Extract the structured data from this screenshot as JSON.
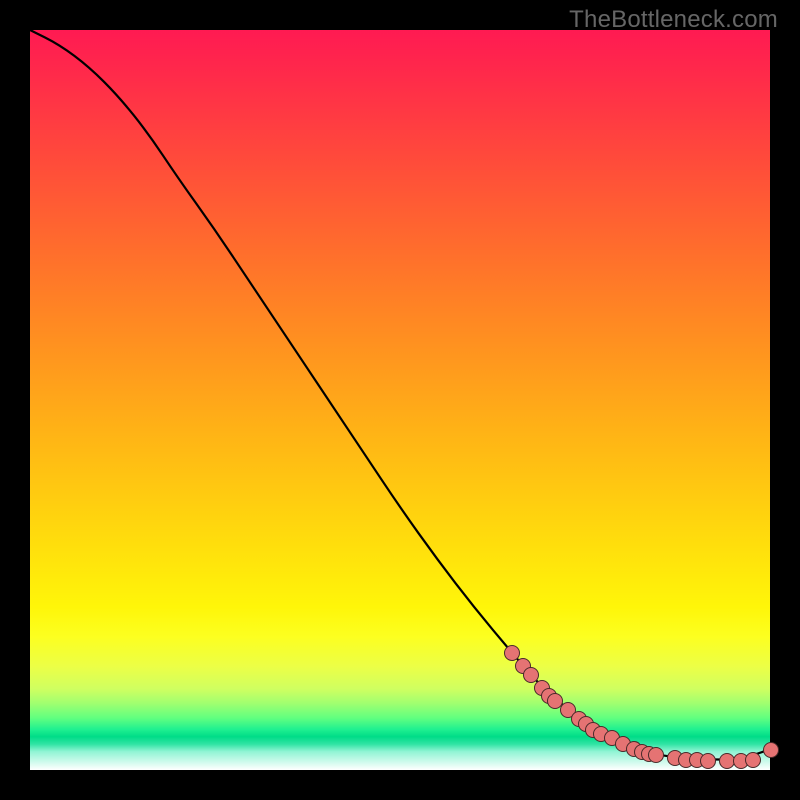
{
  "watermark": "TheBottleneck.com",
  "colors": {
    "background": "#000000",
    "line": "#000000",
    "dot_fill": "#e57373",
    "dot_stroke": "#4a2a2a"
  },
  "chart_data": {
    "type": "line",
    "title": "",
    "xlabel": "",
    "ylabel": "",
    "xlim": [
      0,
      100
    ],
    "ylim": [
      0,
      100
    ],
    "series": [
      {
        "name": "curve",
        "x": [
          0,
          4,
          8,
          12,
          16,
          20,
          25,
          30,
          35,
          40,
          45,
          50,
          55,
          60,
          65,
          68,
          70,
          72,
          74,
          76,
          78,
          80,
          82,
          84,
          88,
          92,
          96,
          100
        ],
        "y": [
          100,
          98,
          95,
          91,
          86,
          80,
          73,
          65.5,
          58,
          50.5,
          43,
          35.5,
          28.5,
          22,
          16,
          12.5,
          10.5,
          8.8,
          7.2,
          5.8,
          4.6,
          3.6,
          2.8,
          2.2,
          1.6,
          1.4,
          1.4,
          2.8
        ]
      }
    ],
    "highlight_points": {
      "x": [
        65,
        66.5,
        67.5,
        69,
        70,
        70.8,
        72.5,
        74,
        75,
        76,
        77,
        78.5,
        80,
        81.5,
        82.5,
        83.5,
        84.5,
        87,
        88.5,
        90,
        91.5,
        94,
        96,
        97.5,
        100
      ],
      "y": [
        16,
        14.2,
        13,
        11.2,
        10.2,
        9.4,
        8.2,
        7,
        6.3,
        5.6,
        5,
        4.4,
        3.6,
        3,
        2.6,
        2.3,
        2.1,
        1.7,
        1.55,
        1.45,
        1.4,
        1.4,
        1.4,
        1.5,
        2.8
      ]
    }
  }
}
